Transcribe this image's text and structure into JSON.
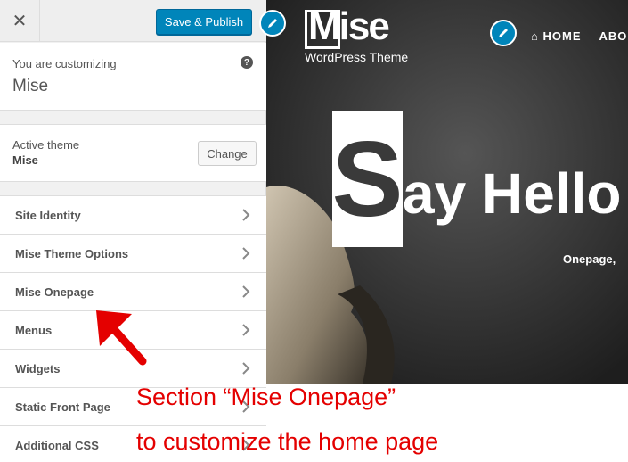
{
  "topbar": {
    "close_icon": "close-icon",
    "publish_label": "Save & Publish"
  },
  "customizing": {
    "label": "You are customizing",
    "theme_name": "Mise",
    "help_glyph": "?"
  },
  "active_theme": {
    "label": "Active theme",
    "name": "Mise",
    "change_label": "Change"
  },
  "menu": {
    "items": [
      {
        "label": "Site Identity"
      },
      {
        "label": "Mise Theme Options"
      },
      {
        "label": "Mise Onepage"
      },
      {
        "label": "Menus"
      },
      {
        "label": "Widgets"
      },
      {
        "label": "Static Front Page"
      },
      {
        "label": "Additional CSS"
      }
    ]
  },
  "preview": {
    "logo_text": "Mise",
    "logo_sub": "WordPress Theme",
    "nav": {
      "home": "HOME",
      "about": "ABO"
    },
    "hero_first_letter": "S",
    "hero_rest": "ay Hello",
    "hero_subtitle": "Onepage,"
  },
  "annotation": {
    "line1": "Section “Mise Onepage”",
    "line2": "to customize the home page",
    "color": "#e40000"
  },
  "colors": {
    "accent": "#0085ba"
  }
}
